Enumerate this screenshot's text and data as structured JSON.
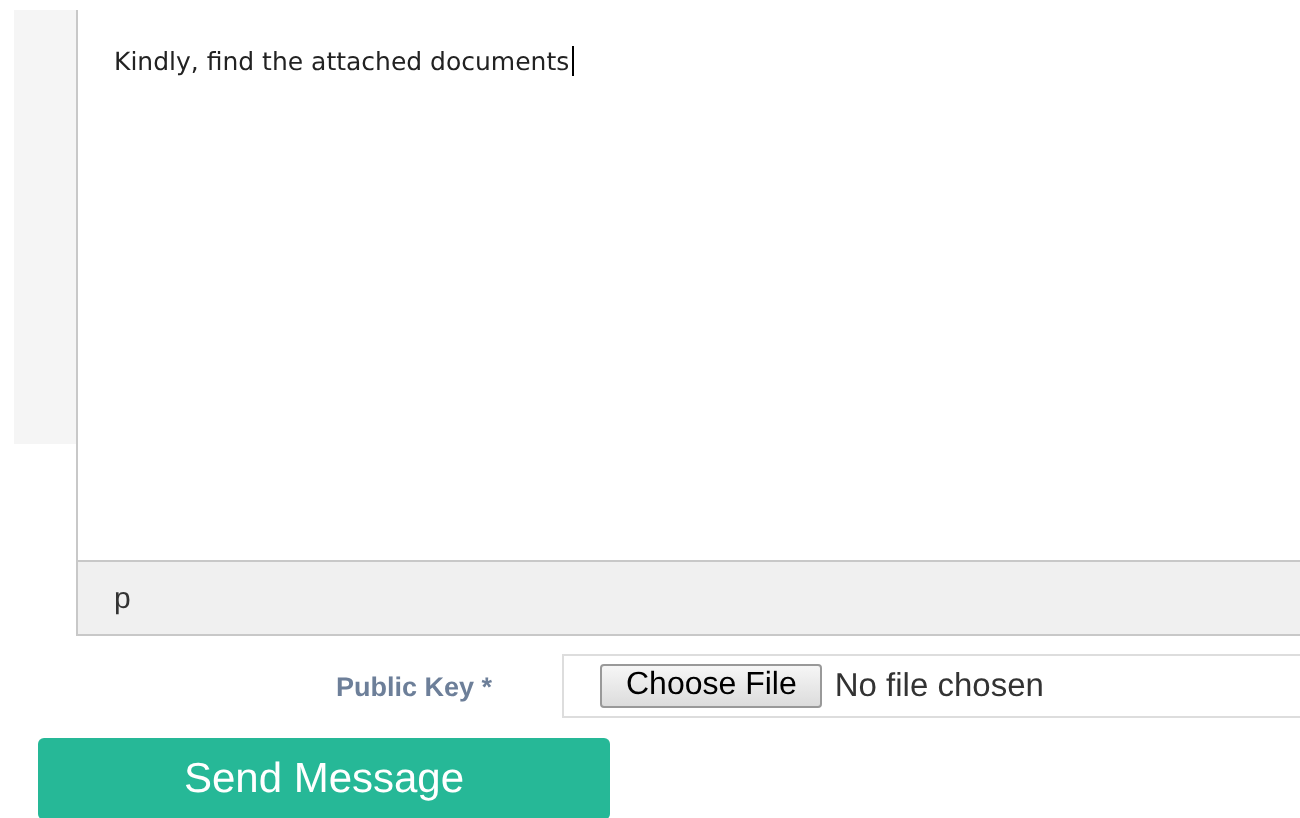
{
  "editor": {
    "value": "Kindly, find the attached documents",
    "path": "p"
  },
  "public_key": {
    "label": "Public Key *",
    "button": "Choose File",
    "status": "No file chosen"
  },
  "submit": {
    "label": "Send Message"
  }
}
